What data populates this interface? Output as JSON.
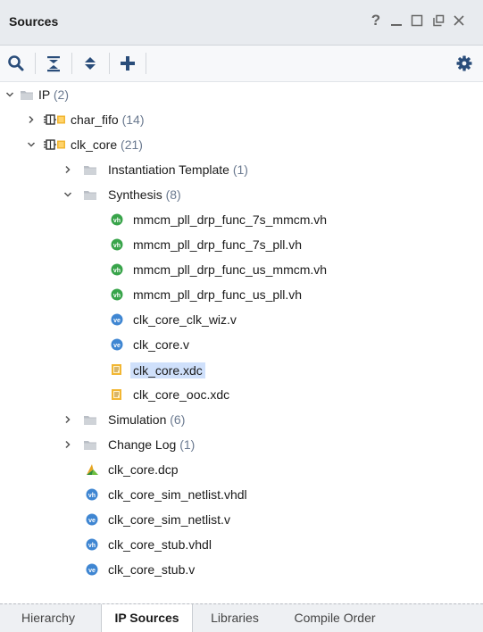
{
  "panel": {
    "title": "Sources",
    "controls": [
      "?",
      "minimize",
      "maximize",
      "float",
      "close"
    ]
  },
  "toolbar": {
    "buttons": [
      "search-icon",
      "collapse-all-icon",
      "expand-all-icon",
      "add-icon"
    ],
    "settings": "gear-icon"
  },
  "tree": {
    "ip": {
      "label": "IP",
      "count": "(2)"
    },
    "char_fifo": {
      "label": "char_fifo",
      "count": "(14)"
    },
    "clk_core": {
      "label": "clk_core",
      "count": "(21)"
    },
    "instantiation_template": {
      "label": "Instantiation Template",
      "count": "(1)"
    },
    "synthesis": {
      "label": "Synthesis",
      "count": "(8)"
    },
    "synthesis_files": [
      "mmcm_pll_drp_func_7s_mmcm.vh",
      "mmcm_pll_drp_func_7s_pll.vh",
      "mmcm_pll_drp_func_us_mmcm.vh",
      "mmcm_pll_drp_func_us_pll.vh",
      "clk_core_clk_wiz.v",
      "clk_core.v",
      "clk_core.xdc",
      "clk_core_ooc.xdc"
    ],
    "simulation": {
      "label": "Simulation",
      "count": "(6)"
    },
    "change_log": {
      "label": "Change Log",
      "count": "(1)"
    },
    "clk_core_files": [
      "clk_core.dcp",
      "clk_core_sim_netlist.vhdl",
      "clk_core_sim_netlist.v",
      "clk_core_stub.vhdl",
      "clk_core_stub.v"
    ],
    "selected": "clk_core.xdc"
  },
  "tabs": [
    "Hierarchy",
    "IP Sources",
    "Libraries",
    "Compile Order"
  ],
  "active_tab": "IP Sources",
  "colors": {
    "accent_selection": "#cfe0fb",
    "verilog_icon": "#3f86d2",
    "header_icon": "#38a44a",
    "count_text": "#6b7a90"
  }
}
